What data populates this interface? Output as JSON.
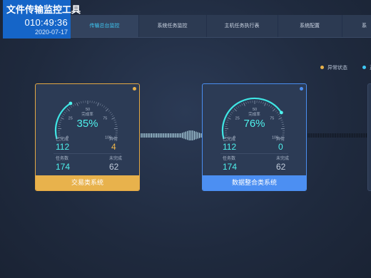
{
  "header": {
    "app_title": "文件传输监控工具",
    "time": "010:49:36",
    "date": "2020-07-17"
  },
  "nav": {
    "tabs": [
      {
        "label": "传输总台监控",
        "active": true
      },
      {
        "label": "系统任务监控",
        "active": false
      },
      {
        "label": "主机任务执行表",
        "active": false
      },
      {
        "label": "系统配置",
        "active": false
      },
      {
        "label": "系",
        "active": false
      }
    ]
  },
  "legend": {
    "items": [
      {
        "label": "异常状态",
        "color": "#e8b24c"
      },
      {
        "label": "正",
        "color": "#3fc8f4"
      }
    ]
  },
  "gauge_ticks": [
    "0",
    "25",
    "50",
    "75",
    "100"
  ],
  "cards": [
    {
      "name": "交易类系统",
      "status_color": "#e8b24c",
      "gauge_label": "完成率",
      "completion_rate": 35,
      "completion_text": "35%",
      "completed_label": "已完成",
      "completed": "112",
      "abnormal_label": "异常",
      "abnormal": "4",
      "tasks_label": "任务数",
      "tasks": "174",
      "pending_label": "未完成",
      "pending": "62"
    },
    {
      "name": "数据整合类系统",
      "status_color": "#4c8ff2",
      "gauge_label": "完成率",
      "completion_rate": 76,
      "completion_text": "76%",
      "completed_label": "已完成",
      "completed": "112",
      "abnormal_label": "异常",
      "abnormal": "0",
      "tasks_label": "任务数",
      "tasks": "174",
      "pending_label": "未完成",
      "pending": "62"
    }
  ]
}
